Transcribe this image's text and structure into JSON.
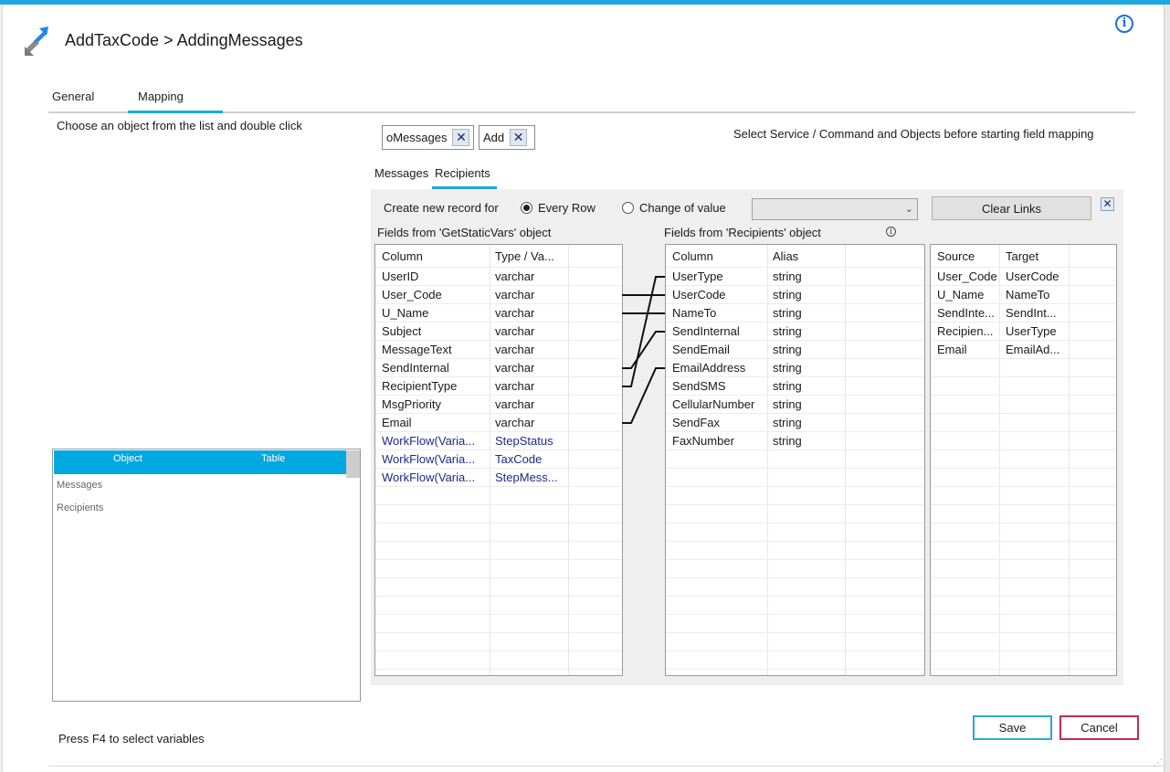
{
  "window": {
    "title": "AddTaxCode > AddingMessages",
    "info_icon": "info-icon"
  },
  "tabs": [
    {
      "label": "General"
    },
    {
      "label": "Mapping",
      "selected": true
    }
  ],
  "left": {
    "hint": "Choose an object from the list and double click",
    "object_table": {
      "headers": [
        "Object",
        "Table"
      ],
      "items": [
        "Messages",
        "Recipients"
      ]
    },
    "f4_hint": "Press F4 to select variables"
  },
  "chips": [
    {
      "label": "oMessages"
    },
    {
      "label": "Add"
    }
  ],
  "select_hint": "Select Service / Command and Objects before starting field mapping",
  "subtabs": [
    {
      "label": "Messages"
    },
    {
      "label": "Recipients",
      "selected": true
    }
  ],
  "record_options": {
    "label": "Create new record for",
    "options": [
      {
        "label": "Every Row",
        "selected": true
      },
      {
        "label": "Change of value",
        "selected": false
      }
    ],
    "dropdown_value": ""
  },
  "clear_links_label": "Clear Links",
  "source_fields": {
    "title": "Fields from 'GetStaticVars' object",
    "headers": [
      "Column",
      "Type / Va..."
    ],
    "rows": [
      {
        "column": "UserID",
        "type": "varchar",
        "variable": false
      },
      {
        "column": "User_Code",
        "type": "varchar",
        "variable": false
      },
      {
        "column": "U_Name",
        "type": "varchar",
        "variable": false
      },
      {
        "column": "Subject",
        "type": "varchar",
        "variable": false
      },
      {
        "column": "MessageText",
        "type": "varchar",
        "variable": false
      },
      {
        "column": "SendInternal",
        "type": "varchar",
        "variable": false
      },
      {
        "column": "RecipientType",
        "type": "varchar",
        "variable": false
      },
      {
        "column": "MsgPriority",
        "type": "varchar",
        "variable": false
      },
      {
        "column": "Email",
        "type": "varchar",
        "variable": false
      },
      {
        "column": "WorkFlow(Varia...",
        "type": "StepStatus",
        "variable": true
      },
      {
        "column": "WorkFlow(Varia...",
        "type": "TaxCode",
        "variable": true
      },
      {
        "column": "WorkFlow(Varia...",
        "type": "StepMess...",
        "variable": true
      }
    ]
  },
  "target_fields": {
    "title": "Fields from 'Recipients' object",
    "headers": [
      "Column",
      "Alias"
    ],
    "rows": [
      {
        "column": "UserType",
        "alias": "string"
      },
      {
        "column": "UserCode",
        "alias": "string"
      },
      {
        "column": "NameTo",
        "alias": "string"
      },
      {
        "column": "SendInternal",
        "alias": "string"
      },
      {
        "column": "SendEmail",
        "alias": "string"
      },
      {
        "column": "EmailAddress",
        "alias": "string"
      },
      {
        "column": "SendSMS",
        "alias": "string"
      },
      {
        "column": "CellularNumber",
        "alias": "string"
      },
      {
        "column": "SendFax",
        "alias": "string"
      },
      {
        "column": "FaxNumber",
        "alias": "string"
      }
    ]
  },
  "mappings": {
    "headers": [
      "Source",
      "Target"
    ],
    "rows": [
      {
        "source": "User_Code",
        "target": "UserCode"
      },
      {
        "source": "U_Name",
        "target": "NameTo"
      },
      {
        "source": "SendInte...",
        "target": "SendInt..."
      },
      {
        "source": "Recipien...",
        "target": "UserType"
      },
      {
        "source": "Email",
        "target": "EmailAd..."
      }
    ]
  },
  "links": [
    {
      "from": "User_Code",
      "to": "UserCode"
    },
    {
      "from": "U_Name",
      "to": "NameTo"
    },
    {
      "from": "SendInternal",
      "to": "SendInternal"
    },
    {
      "from": "RecipientType",
      "to": "UserType"
    },
    {
      "from": "Email",
      "to": "EmailAddress"
    }
  ],
  "buttons": {
    "save": "Save",
    "cancel": "Cancel"
  },
  "colors": {
    "accent": "#1ea7e1",
    "cancel_border": "#c42a55",
    "variable_text": "#1c2a8c"
  }
}
